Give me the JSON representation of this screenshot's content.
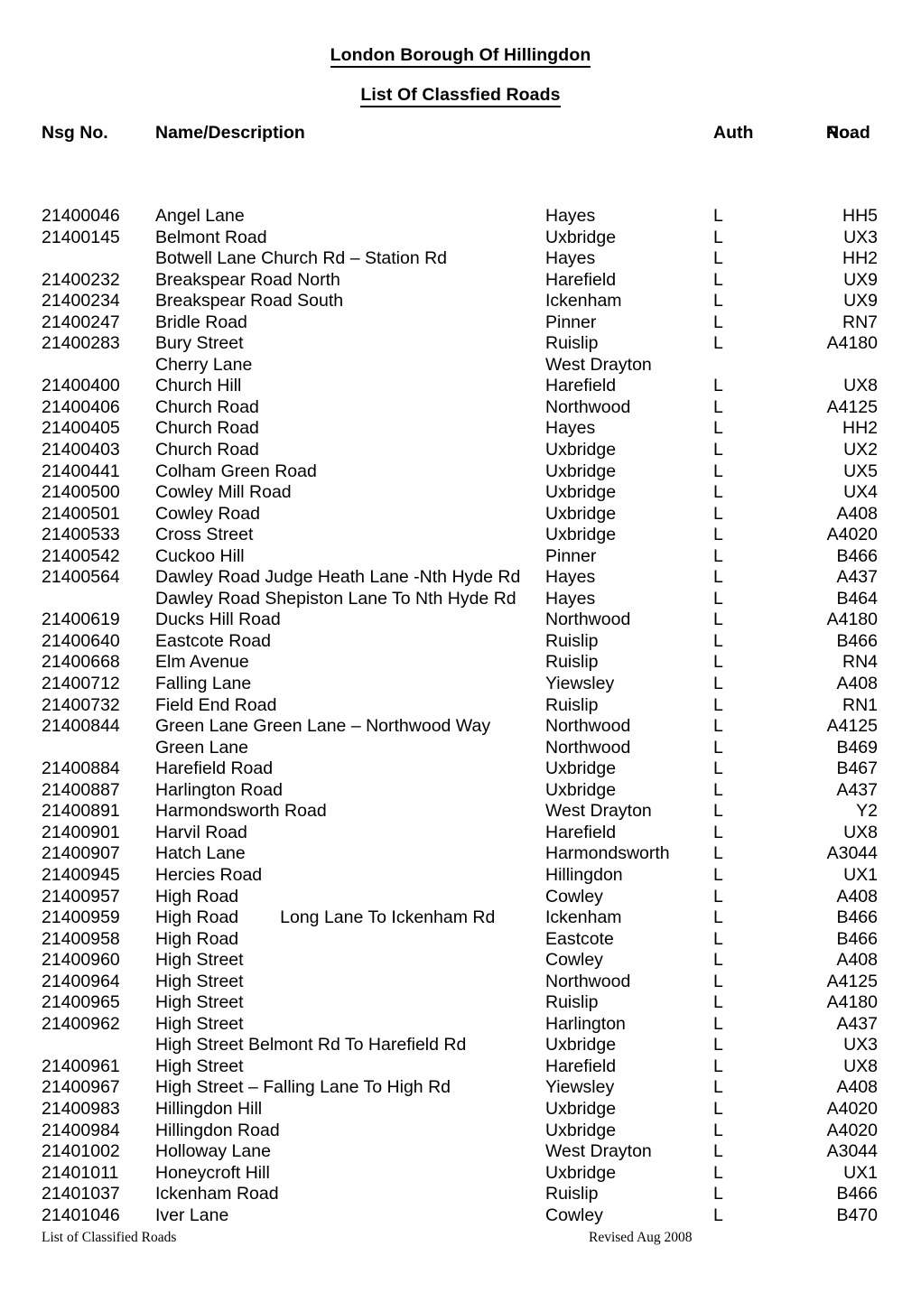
{
  "document": {
    "title_main": "London Borough Of Hillingdon",
    "title_sub": "List Of Classfied Roads"
  },
  "columns": {
    "nsg_no": "Nsg No.",
    "name_description": "Name/Description",
    "auth": "Auth",
    "road_no_line1": "Road",
    "road_no_line2": "No."
  },
  "footer": {
    "left": "List of Classified Roads",
    "right": "Revised Aug 2008"
  },
  "rows": [
    {
      "nsg": "21400046",
      "name": "Angel Lane",
      "town": "Hayes",
      "auth": "L",
      "road": "HH5"
    },
    {
      "nsg": "21400145",
      "name": "Belmont Road",
      "town": "Uxbridge",
      "auth": "L",
      "road": "UX3"
    },
    {
      "nsg": "",
      "name": "Botwell Lane Church Rd – Station Rd",
      "town": "Hayes",
      "auth": "L",
      "road": "HH2"
    },
    {
      "nsg": "21400232",
      "name": "Breakspear Road North",
      "town": "Harefield",
      "auth": "L",
      "road": "UX9"
    },
    {
      "nsg": "21400234",
      "name": "Breakspear Road South",
      "town": "Ickenham",
      "auth": "L",
      "road": "UX9"
    },
    {
      "nsg": "21400247",
      "name": "Bridle Road",
      "town": "Pinner",
      "auth": "L",
      "road": "RN7"
    },
    {
      "nsg": "21400283",
      "name": "Bury Street",
      "town": "Ruislip",
      "auth": "L",
      "road": "A4180"
    },
    {
      "nsg": "",
      "name": "Cherry Lane",
      "town": "West Drayton",
      "auth": "",
      "road": ""
    },
    {
      "nsg": "21400400",
      "name": "Church Hill",
      "town": "Harefield",
      "auth": "L",
      "road": "UX8"
    },
    {
      "nsg": "21400406",
      "name": "Church Road",
      "town": "Northwood",
      "auth": "L",
      "road": "A4125"
    },
    {
      "nsg": "21400405",
      "name": "Church Road",
      "town": "Hayes",
      "auth": "L",
      "road": "HH2"
    },
    {
      "nsg": "21400403",
      "name": "Church Road",
      "town": "Uxbridge",
      "auth": "L",
      "road": "UX2"
    },
    {
      "nsg": "21400441",
      "name": "Colham Green Road",
      "town": "Uxbridge",
      "auth": "L",
      "road": "UX5"
    },
    {
      "nsg": "21400500",
      "name": "Cowley Mill Road",
      "town": "Uxbridge",
      "auth": "L",
      "road": "UX4"
    },
    {
      "nsg": "21400501",
      "name": "Cowley Road",
      "town": "Uxbridge",
      "auth": "L",
      "road": "A408"
    },
    {
      "nsg": "21400533",
      "name": "Cross Street",
      "town": "Uxbridge",
      "auth": "L",
      "road": "A4020"
    },
    {
      "nsg": "21400542",
      "name": "Cuckoo Hill",
      "town": "Pinner",
      "auth": "L",
      "road": "B466"
    },
    {
      "nsg": "21400564",
      "name": "Dawley Road Judge Heath Lane -Nth Hyde Rd",
      "town": "Hayes",
      "auth": "L",
      "road": "A437"
    },
    {
      "nsg": "",
      "name": "Dawley Road Shepiston Lane To Nth Hyde Rd",
      "town": "Hayes",
      "auth": "L",
      "road": "B464"
    },
    {
      "nsg": "21400619",
      "name": "Ducks Hill Road",
      "town": "Northwood",
      "auth": "L",
      "road": "A4180"
    },
    {
      "nsg": "21400640",
      "name": "Eastcote Road",
      "town": "Ruislip",
      "auth": "L",
      "road": "B466"
    },
    {
      "nsg": "21400668",
      "name": "Elm Avenue",
      "town": "Ruislip",
      "auth": "L",
      "road": "RN4"
    },
    {
      "nsg": "21400712",
      "name": "Falling Lane",
      "town": "Yiewsley",
      "auth": "L",
      "road": "A408"
    },
    {
      "nsg": "21400732",
      "name": "Field End Road",
      "town": "Ruislip",
      "auth": "L",
      "road": "RN1"
    },
    {
      "nsg": "21400844",
      "name": "Green Lane Green Lane – Northwood Way",
      "town": "Northwood",
      "auth": "L",
      "road": "A4125"
    },
    {
      "nsg": "",
      "name": "Green Lane",
      "town": "Northwood",
      "auth": "L",
      "road": "B469"
    },
    {
      "nsg": "21400884",
      "name": "Harefield Road",
      "town": "Uxbridge",
      "auth": "L",
      "road": "B467"
    },
    {
      "nsg": "21400887",
      "name": "Harlington Road",
      "town": "Uxbridge",
      "auth": "L",
      "road": "A437"
    },
    {
      "nsg": "21400891",
      "name": "Harmondsworth Road",
      "town": "West Drayton",
      "auth": "L",
      "road": "Y2"
    },
    {
      "nsg": "21400901",
      "name": "Harvil Road",
      "town": "Harefield",
      "auth": "L",
      "road": "UX8"
    },
    {
      "nsg": "21400907",
      "name": "Hatch Lane",
      "town": "Harmondsworth",
      "auth": "L",
      "road": "A3044"
    },
    {
      "nsg": "21400945",
      "name": "Hercies Road",
      "town": "Hillingdon",
      "auth": "L",
      "road": "UX1"
    },
    {
      "nsg": "21400957",
      "name": "High Road",
      "town": "Cowley",
      "auth": "L",
      "road": "A408"
    },
    {
      "nsg": "21400959",
      "name": "High Road",
      "name_extra": "Long Lane To Ickenham Rd",
      "town": "Ickenham",
      "auth": "L",
      "road": "B466"
    },
    {
      "nsg": "21400958",
      "name": "High Road",
      "town": "Eastcote",
      "auth": "L",
      "road": "B466"
    },
    {
      "nsg": "21400960",
      "name": "High Street",
      "town": "Cowley",
      "auth": "L",
      "road": "A408"
    },
    {
      "nsg": "21400964",
      "name": "High Street",
      "town": "Northwood",
      "auth": "L",
      "road": "A4125"
    },
    {
      "nsg": "21400965",
      "name": "High Street",
      "town": "Ruislip",
      "auth": "L",
      "road": "A4180"
    },
    {
      "nsg": "21400962",
      "name": "High Street",
      "town": "Harlington",
      "auth": "L",
      "road": "A437"
    },
    {
      "nsg": "",
      "name": "High Street Belmont Rd To Harefield Rd",
      "town": "Uxbridge",
      "auth": "L",
      "road": "UX3"
    },
    {
      "nsg": "21400961",
      "name": "High Street",
      "town": "Harefield",
      "auth": "L",
      "road": "UX8"
    },
    {
      "nsg": "21400967",
      "name": "High Street – Falling Lane To High Rd",
      "town": "Yiewsley",
      "auth": "L",
      "road": "A408"
    },
    {
      "nsg": "21400983",
      "name": "Hillingdon Hill",
      "town": "Uxbridge",
      "auth": "L",
      "road": "A4020"
    },
    {
      "nsg": "21400984",
      "name": "Hillingdon Road",
      "town": "Uxbridge",
      "auth": "L",
      "road": "A4020"
    },
    {
      "nsg": "21401002",
      "name": "Holloway Lane",
      "town": "West Drayton",
      "auth": "L",
      "road": "A3044"
    },
    {
      "nsg": "21401011",
      "name": "Honeycroft Hill",
      "town": "Uxbridge",
      "auth": "L",
      "road": "UX1"
    },
    {
      "nsg": "21401037",
      "name": "Ickenham Road",
      "town": "Ruislip",
      "auth": "L",
      "road": "B466"
    },
    {
      "nsg": "21401046",
      "name": "Iver Lane",
      "town": "Cowley",
      "auth": "L",
      "road": "B470"
    }
  ]
}
